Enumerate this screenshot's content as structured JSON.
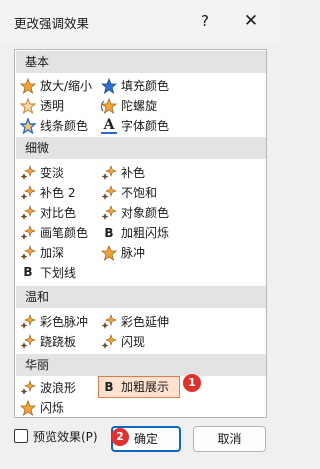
{
  "dialog": {
    "title": "更改强调效果",
    "help_icon": "?",
    "close_icon": "✕"
  },
  "groups": [
    {
      "name": "基本",
      "items": [
        {
          "label": "放大/缩小",
          "icon": "star-orange-icon"
        },
        {
          "label": "填充颜色",
          "icon": "paint-bucket-icon"
        },
        {
          "label": "透明",
          "icon": "star-transparent-icon"
        },
        {
          "label": "陀螺旋",
          "icon": "spin-icon"
        },
        {
          "label": "线条颜色",
          "icon": "star-line-icon"
        },
        {
          "label": "字体颜色",
          "icon": "font-color-icon",
          "glyph": "A"
        }
      ]
    },
    {
      "name": "细微",
      "items": [
        {
          "label": "变淡",
          "icon": "sparkle-icon"
        },
        {
          "label": "补色",
          "icon": "sparkle-icon"
        },
        {
          "label": "补色 2",
          "icon": "sparkle-icon"
        },
        {
          "label": "不饱和",
          "icon": "sparkle-icon"
        },
        {
          "label": "对比色",
          "icon": "sparkle-icon"
        },
        {
          "label": "对象颜色",
          "icon": "sparkle-icon"
        },
        {
          "label": "画笔颜色",
          "icon": "sparkle-icon"
        },
        {
          "label": "加粗闪烁",
          "icon": "bold-icon",
          "glyph": "B"
        },
        {
          "label": "加深",
          "icon": "sparkle-icon"
        },
        {
          "label": "脉冲",
          "icon": "star-orange-icon"
        },
        {
          "label": "下划线",
          "icon": "underline-icon",
          "glyph": "B"
        }
      ]
    },
    {
      "name": "温和",
      "items": [
        {
          "label": "彩色脉冲",
          "icon": "sparkle-icon"
        },
        {
          "label": "彩色延伸",
          "icon": "sparkle-icon"
        },
        {
          "label": "跷跷板",
          "icon": "sparkle-icon"
        },
        {
          "label": "闪现",
          "icon": "sparkle-icon"
        }
      ]
    },
    {
      "name": "华丽",
      "items": [
        {
          "label": "波浪形",
          "icon": "sparkle-icon"
        },
        {
          "label": "加粗展示",
          "icon": "bold-icon",
          "glyph": "B",
          "selected": true
        },
        {
          "label": "闪烁",
          "icon": "star-orange-icon"
        }
      ]
    }
  ],
  "badges": {
    "one": "1",
    "two": "2"
  },
  "footer": {
    "preview_label": "预览效果(P)",
    "ok_label": "确定",
    "cancel_label": "取消"
  }
}
